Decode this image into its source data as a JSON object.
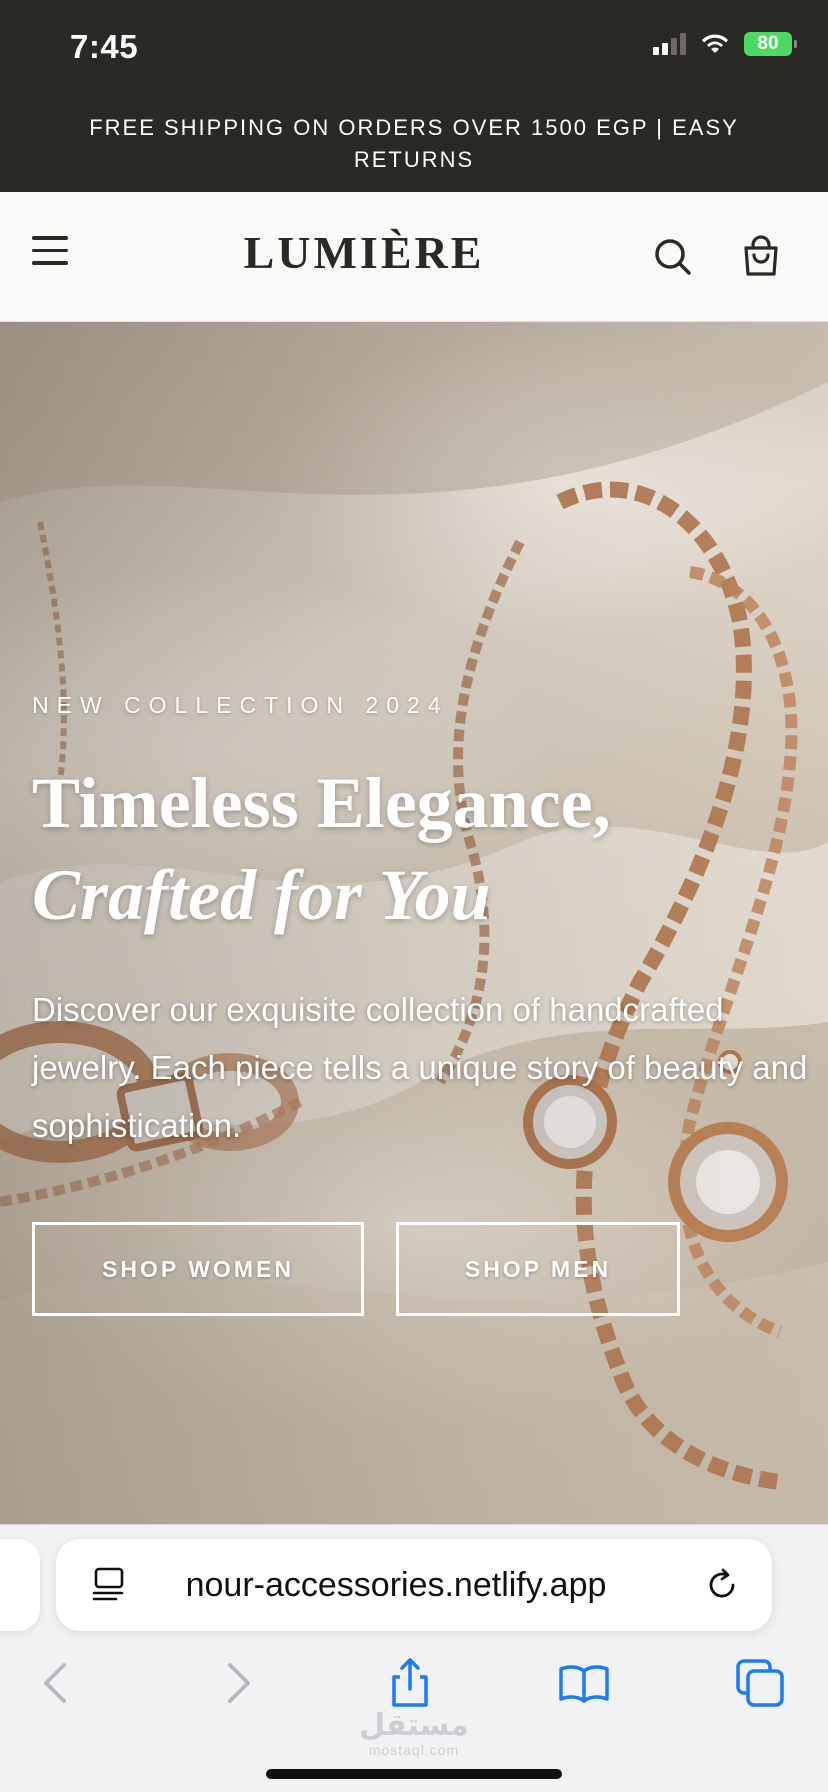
{
  "status_bar": {
    "time": "7:45",
    "battery": "80"
  },
  "announcement": {
    "text": "FREE SHIPPING ON ORDERS OVER 1500 EGP | EASY RETURNS"
  },
  "header": {
    "logo": "LUMIÈRE"
  },
  "hero": {
    "eyebrow": "NEW COLLECTION 2024",
    "title_line1": "Timeless Elegance,",
    "title_line2": "Crafted for You",
    "description": "Discover our exquisite collection of handcrafted jewelry. Each piece tells a unique story of beauty and sophistication.",
    "button_women": "SHOP WOMEN",
    "button_men": "SHOP MEN"
  },
  "browser": {
    "url": "nour-accessories.netlify.app",
    "watermark_ar": "مستقل",
    "watermark_en": "mostaql.com"
  },
  "colors": {
    "dark": "#2b2925",
    "header_bg": "#fbfaf8",
    "battery_green": "#4cd964",
    "ios_blue": "#1a7cf5"
  },
  "icons": [
    "signal-icon",
    "wifi-icon",
    "battery-icon",
    "hamburger-menu-icon",
    "search-icon",
    "shopping-bag-icon",
    "reader-mode-icon",
    "reload-icon",
    "back-arrow-icon",
    "forward-arrow-icon",
    "share-icon",
    "bookmarks-icon",
    "tabs-icon"
  ]
}
